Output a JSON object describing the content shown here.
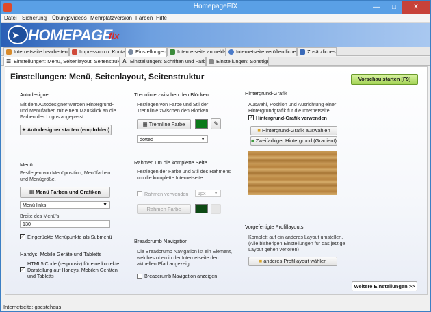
{
  "window": {
    "title": "HomepageFIX"
  },
  "menubar": {
    "items": [
      "Datei",
      "Sicherung",
      "Übungsvideos",
      "Mehrplatzversion",
      "Farben",
      "Hilfe"
    ]
  },
  "logo": {
    "text": "HOMEPAGE",
    "suffix": "fix"
  },
  "main_tabs": [
    {
      "label": "Internetseite bearbeiten"
    },
    {
      "label": "Impressum u. Kontakt"
    },
    {
      "label": "Einstellungen",
      "active": true
    },
    {
      "label": "Internetseite anmelden"
    },
    {
      "label": "Internetseite veröffentlichen"
    },
    {
      "label": "Zusätzliches"
    }
  ],
  "sub_tabs": [
    {
      "label": "Einstellungen: Menü, Seitenlayout, Seitenstruktur",
      "active": true
    },
    {
      "label": "Einstellungen: Schriften und Farben"
    },
    {
      "label": "Einstellungen: Sonstiges"
    }
  ],
  "page": {
    "heading": "Einstellungen: Menü, Seitenlayout, Seitenstruktur",
    "preview_button": "Vorschau starten [F9]",
    "more_button": "Weitere Einstellungen >>"
  },
  "autodesigner": {
    "title": "Autodesigner",
    "desc": [
      "Mit dem Autodesigner werden Hintergrund-",
      "und Menüfarben mit einem Mausklick an die",
      "Farben des Logos angepasst."
    ],
    "button": "Autodesigner starten (empfohlen)"
  },
  "menu": {
    "title": "Menü",
    "desc": [
      "Festlegen von Menüposition, Menüfarben",
      "und Menügröße."
    ],
    "button": "Menü Farben und Grafiken",
    "position_select": "Menü links",
    "width_label": "Breite des Menü's",
    "width_value": "130",
    "indent_checkbox": "Eingerückte Menüpunkte als Submenü",
    "indent_checked": true
  },
  "mobile": {
    "title": "Handys, Mobile Geräte und Tabletts",
    "checkbox": [
      "HTML5 Code (responsiv) für eine korrekte",
      "Darstellung auf Handys, Mobilen Geräten",
      "und Tabletts"
    ],
    "checked": true
  },
  "separator": {
    "title": "Trennlinie zwischen den Blöcken",
    "desc": [
      "Festlegen von Farbe und Stil der",
      "Trennlinie zwischen den Blöcken."
    ],
    "color_button": "Trennline Farbe",
    "color": "#0a7a1a",
    "style_select": "dotted"
  },
  "frame": {
    "title": "Rahmen um die komplette Seite",
    "desc": [
      "Festlegen der Farbe und Stil des Rahmens",
      "um die komplette Internetseite."
    ],
    "use_checkbox": "Rahmen verwenden",
    "use_checked": false,
    "size_select": "1px",
    "color_button": "Rahmen Farbe",
    "color": "#0d4a14"
  },
  "breadcrumb": {
    "title": "Breadcrumb Navigation",
    "desc": [
      "Die Breadcrumb Navigation ist ein Element,",
      "welches oben in der Internetseite den",
      "aktuellen Pfad angezeigt."
    ],
    "checkbox": "Breadcrumb Navigation anzeigen",
    "checked": false
  },
  "background": {
    "title": "Hintergrund-Grafik",
    "desc": [
      "Auswahl, Position und Ausrichtung einer",
      "Hintergrundgrafik für die Internetseite"
    ],
    "use_checkbox": "Hintergrund-Grafik verwenden",
    "use_checked": true,
    "select_button": "Hintergrund-Grafik auswählen",
    "gradient_button": "Zweifarbiger Hintergrund (Gradient)"
  },
  "profiles": {
    "title": "Vorgefertigte Profillayouts",
    "desc": [
      "Komplett auf ein anderes Layout umstellen.",
      "(Alle bisherigen Einstellungen für das jetzige",
      "Layout gehen verloren)"
    ],
    "button": "anderes Profillayout wählen"
  },
  "status": {
    "text": "Internetseite: gaestehaus"
  },
  "colors": {
    "accent": "#5aa0e6",
    "preview_green": "#a5d456",
    "close_red": "#c7423a"
  }
}
